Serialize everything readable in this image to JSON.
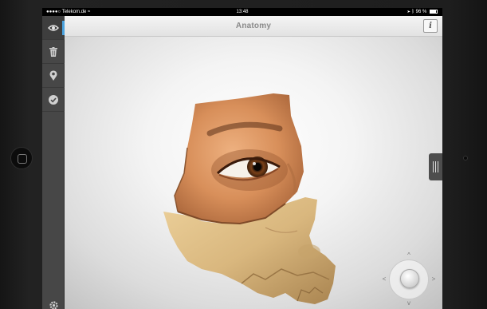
{
  "status_bar": {
    "carrier": "Telekom.de",
    "time": "13:48",
    "battery": "96 %"
  },
  "nav_bar": {
    "title": "Anatomy",
    "info_label": "i"
  },
  "sidebar": {
    "items": [
      {
        "name": "view",
        "icon": "eye-icon",
        "active": true
      },
      {
        "name": "delete",
        "icon": "trash-icon",
        "active": false
      },
      {
        "name": "pin",
        "icon": "map-pin-icon",
        "active": false
      },
      {
        "name": "check",
        "icon": "check-circle-icon",
        "active": false
      }
    ],
    "settings_icon": "gear-icon"
  },
  "joystick": {
    "up": "^",
    "down": "v",
    "left": "<",
    "right": ">"
  },
  "colors": {
    "accent": "#4aa3df",
    "sidebar": "#474747",
    "bone": "#d9b77e",
    "skin": "#d88f5a"
  }
}
